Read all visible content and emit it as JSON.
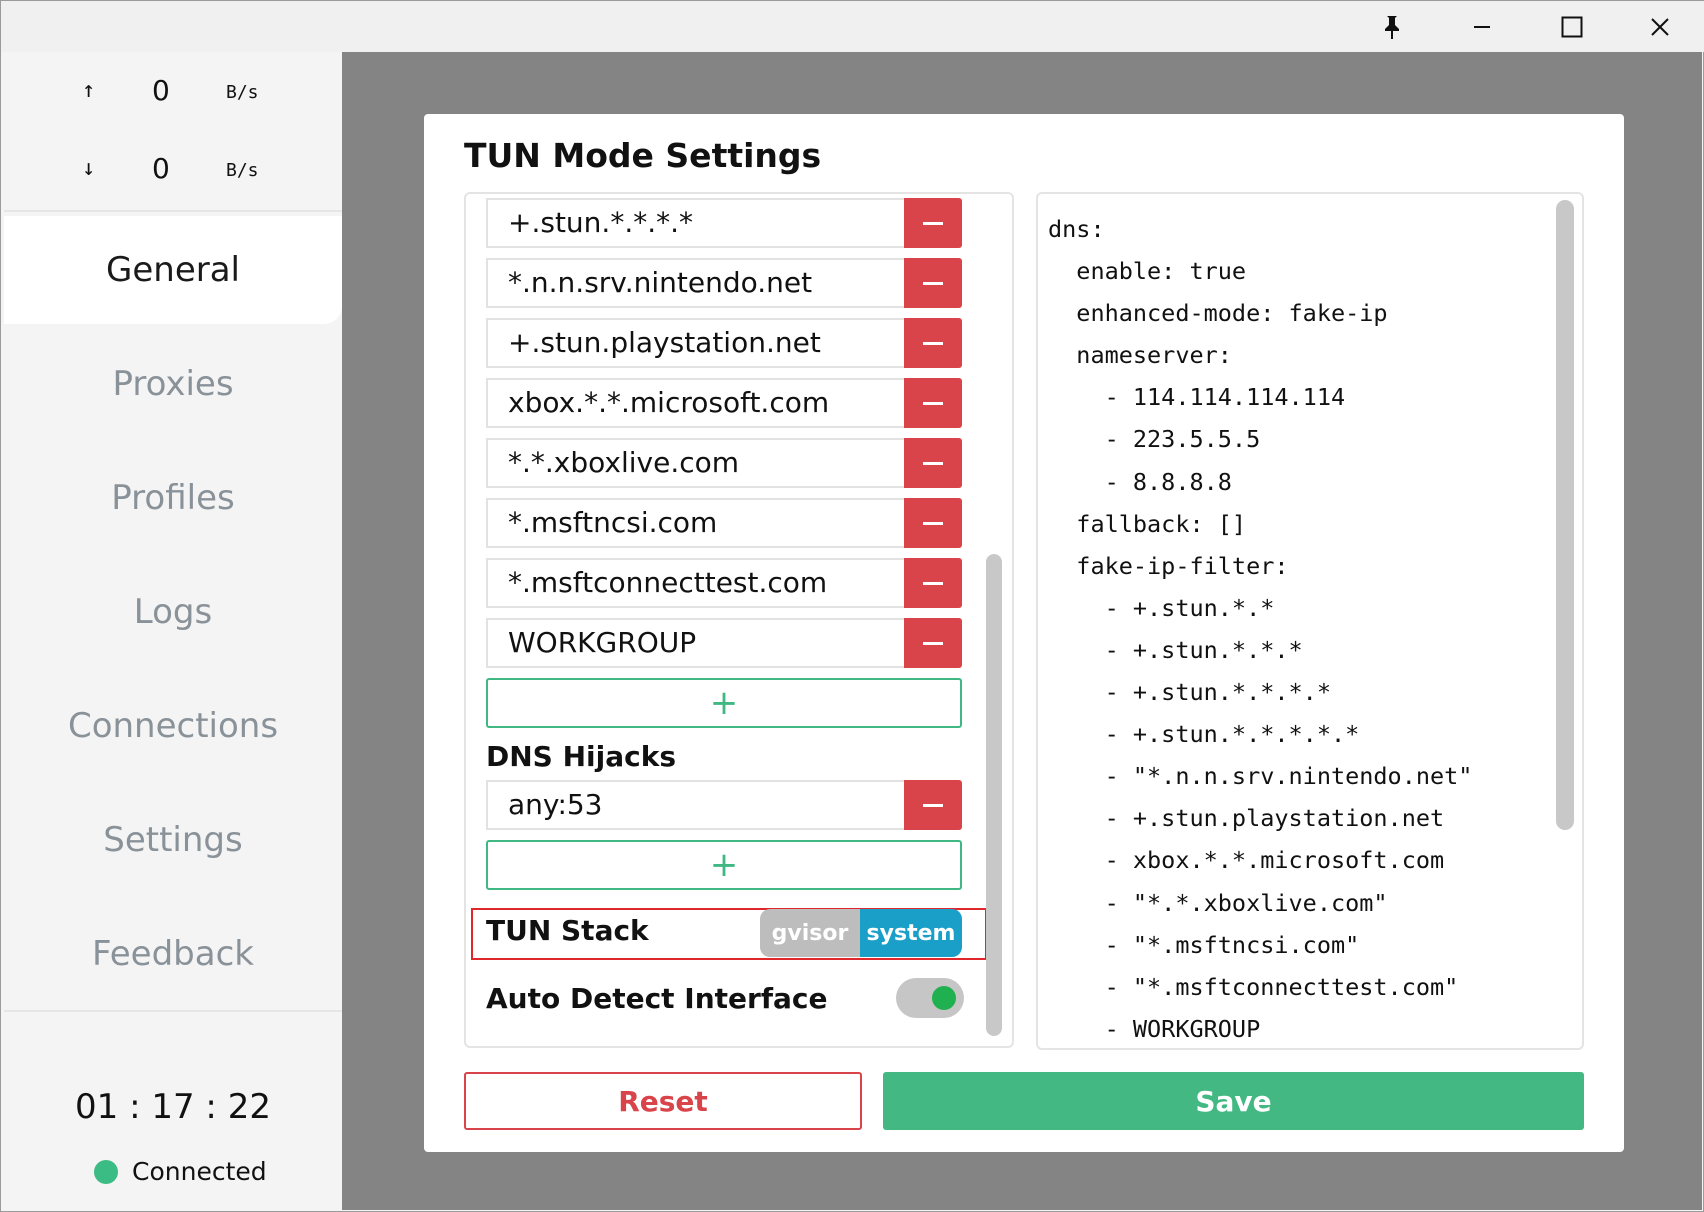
{
  "titlebar": {
    "pin_icon": "pin-icon",
    "minimize_icon": "minimize-icon",
    "maximize_icon": "maximize-icon",
    "close_icon": "close-icon"
  },
  "sidebar": {
    "traffic": {
      "up_arrow": "↑",
      "up_value": "0",
      "up_unit": "B/s",
      "down_arrow": "↓",
      "down_value": "0",
      "down_unit": "B/s"
    },
    "nav": [
      "General",
      "Proxies",
      "Profiles",
      "Logs",
      "Connections",
      "Settings",
      "Feedback"
    ],
    "active_index": 0,
    "uptime": "01 : 17 : 22",
    "status": "Connected",
    "status_color": "#3bbc84"
  },
  "modal": {
    "title": "TUN Mode Settings",
    "fake_ip_filter_items": [
      "+.stun.*.*.*.*",
      "*.n.n.srv.nintendo.net",
      "+.stun.playstation.net",
      "xbox.*.*.microsoft.com",
      "*.*.xboxlive.com",
      "*.msftncsi.com",
      "*.msftconnecttest.com",
      "WORKGROUP"
    ],
    "add_label": "+",
    "dns_hijacks_label": "DNS Hijacks",
    "dns_hijacks": [
      "any:53"
    ],
    "tun_stack_label": "TUN Stack",
    "tun_stack_options": [
      "gvisor",
      "system"
    ],
    "tun_stack_selected": "system",
    "auto_detect_label": "Auto Detect Interface",
    "auto_detect_enabled": true,
    "yaml_lines": [
      "dns:",
      "  enable: true",
      "  enhanced-mode: fake-ip",
      "  nameserver:",
      "    - 114.114.114.114",
      "    - 223.5.5.5",
      "    - 8.8.8.8",
      "  fallback: []",
      "  fake-ip-filter:",
      "    - +.stun.*.*",
      "    - +.stun.*.*.*",
      "    - +.stun.*.*.*.*",
      "    - +.stun.*.*.*.*.*",
      "    - \"*.n.n.srv.nintendo.net\"",
      "    - +.stun.playstation.net",
      "    - xbox.*.*.microsoft.com",
      "    - \"*.*.xboxlive.com\"",
      "    - \"*.msftncsi.com\"",
      "    - \"*.msftconnecttest.com\"",
      "    - WORKGROUP"
    ],
    "reset_label": "Reset",
    "save_label": "Save",
    "colors": {
      "danger": "#d9434a",
      "success": "#43b883",
      "accent": "#1a9fc8"
    }
  }
}
